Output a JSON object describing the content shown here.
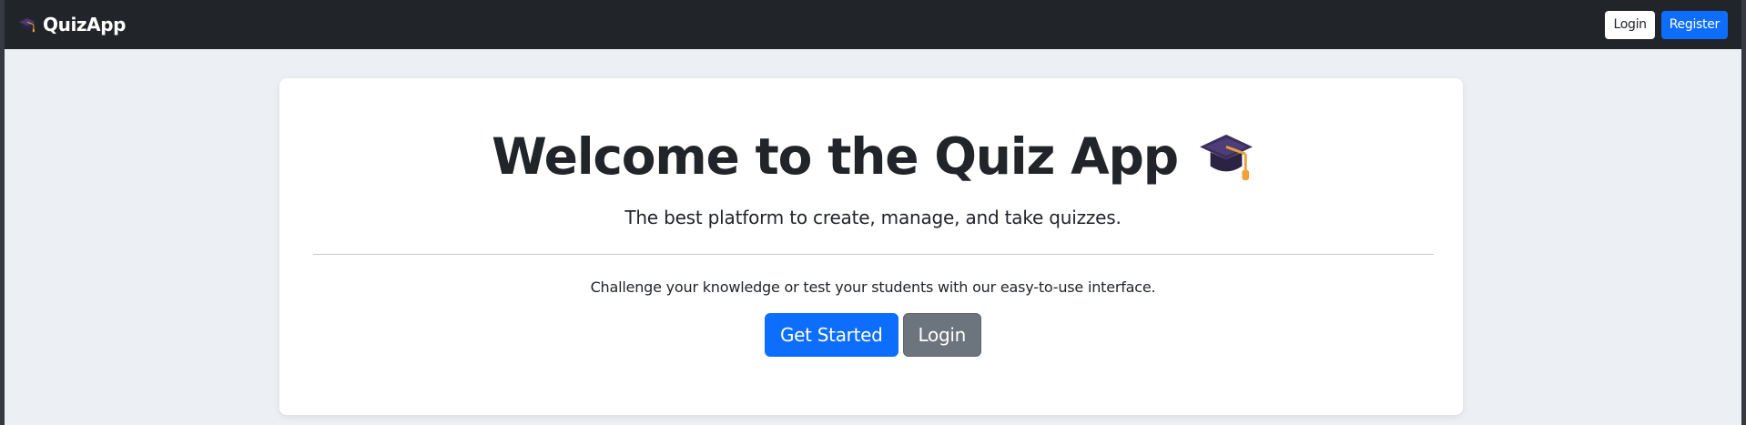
{
  "navbar": {
    "brand_icon": "graduation-cap-icon",
    "brand": "QuizApp",
    "login_label": "Login",
    "register_label": "Register"
  },
  "hero": {
    "title": "Welcome to the Quiz App",
    "title_icon": "graduation-cap-icon",
    "subtitle": "The best platform to create, manage, and take quizzes.",
    "lead": "Challenge your knowledge or test your students with our easy-to-use interface.",
    "get_started_label": "Get Started",
    "login_label": "Login"
  },
  "colors": {
    "navbar_bg": "#212529",
    "page_bg": "#eceff3",
    "primary": "#0d6efd",
    "secondary": "#6c757d",
    "card_bg": "#ffffff"
  }
}
